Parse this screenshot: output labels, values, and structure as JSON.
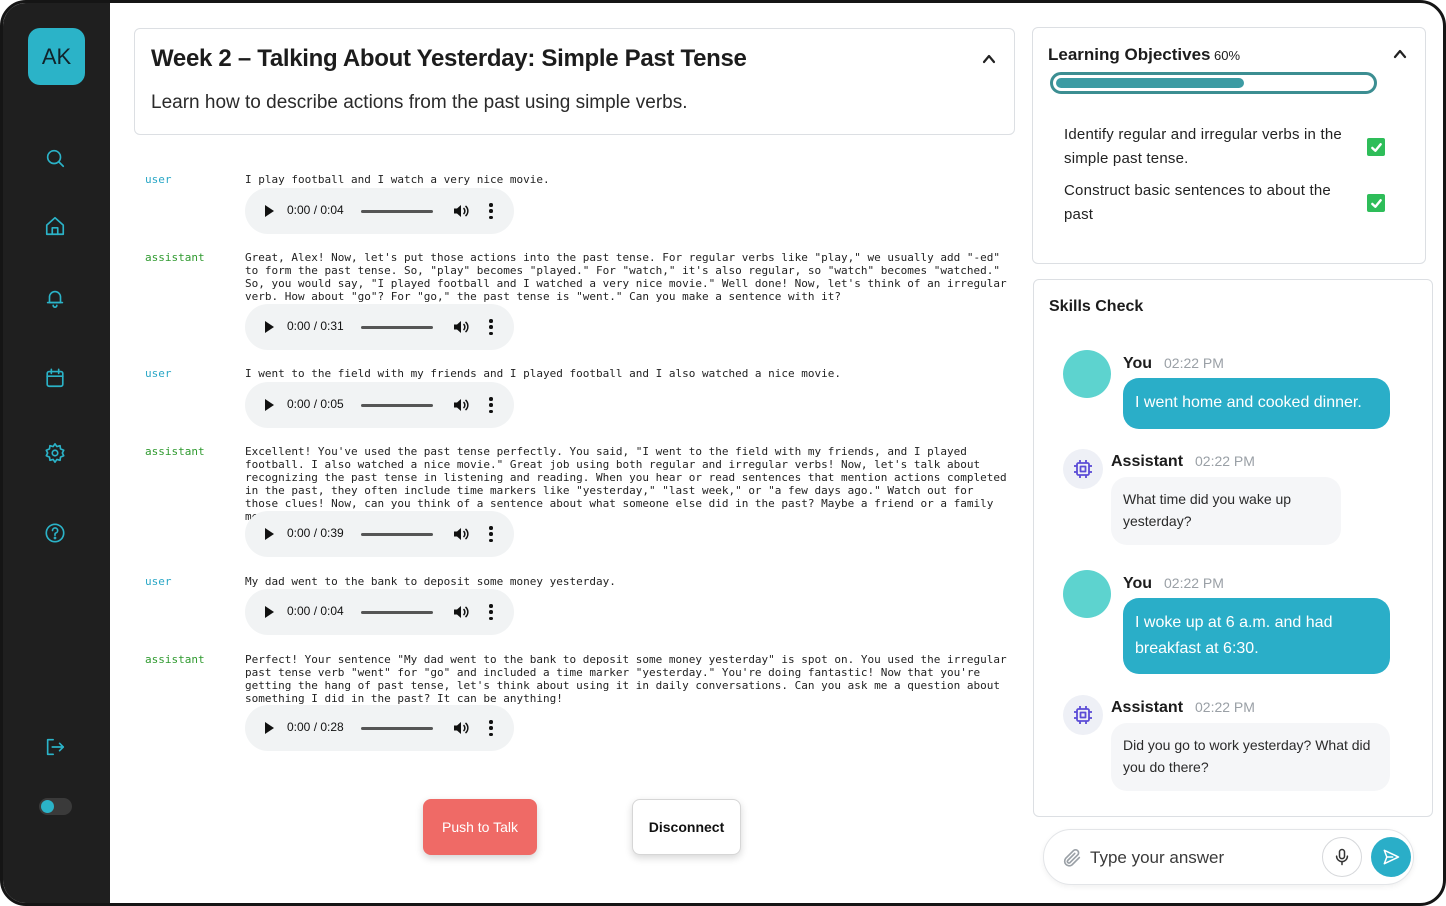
{
  "sidebar": {
    "avatar_initials": "AK",
    "items": [
      {
        "name": "search",
        "icon": "search-icon"
      },
      {
        "name": "home",
        "icon": "home-icon"
      },
      {
        "name": "notifications",
        "icon": "bell-icon"
      },
      {
        "name": "calendar",
        "icon": "calendar-icon"
      },
      {
        "name": "settings",
        "icon": "gear-icon"
      },
      {
        "name": "help",
        "icon": "help-icon"
      },
      {
        "name": "logout",
        "icon": "logout-icon"
      }
    ],
    "theme_toggle": "theme-toggle"
  },
  "lesson": {
    "title": "Week 2 – Talking About Yesterday: Simple Past Tense",
    "subtitle": "Learn how to describe actions from the past using simple verbs."
  },
  "transcript": [
    {
      "role": "user",
      "text": "I play football and I watch a very nice movie.",
      "audio_time": "0:00 / 0:04"
    },
    {
      "role": "assistant",
      "text": "Great, Alex! Now, let's put those actions into the past tense. For regular verbs like \"play,\" we usually add \"-ed\" to form the past tense. So, \"play\" becomes \"played.\" For \"watch,\" it's also regular, so \"watch\" becomes \"watched.\" So, you would say, \"I played football and I watched a very nice movie.\" Well done! Now, let's think of an irregular verb. How about \"go\"? For \"go,\" the past tense is \"went.\" Can you make a sentence with it?",
      "audio_time": "0:00 / 0:31"
    },
    {
      "role": "user",
      "text": "I went to the field with my friends and I played football and I also watched a nice movie.",
      "audio_time": "0:00 / 0:05"
    },
    {
      "role": "assistant",
      "text": "Excellent! You've used the past tense perfectly. You said, \"I went to the field with my friends, and I played football. I also watched a nice movie.\" Great job using both regular and irregular verbs! Now, let's talk about recognizing the past tense in listening and reading. When you hear or read sentences that mention actions completed in the past, they often include time markers like \"yesterday,\" \"last week,\" or \"a few days ago.\" Watch out for those clues! Now, can you think of a sentence about what someone else did in the past? Maybe a friend or a family member?",
      "audio_time": "0:00 / 0:39"
    },
    {
      "role": "user",
      "text": "My dad went to the bank to deposit some money yesterday.",
      "audio_time": "0:00 / 0:04"
    },
    {
      "role": "assistant",
      "text": "Perfect! Your sentence \"My dad went to the bank to deposit some money yesterday\" is spot on. You used the irregular past tense verb \"went\" for \"go\" and included a time marker \"yesterday.\" You're doing fantastic! Now that you're getting the hang of past tense, let's think about using it in daily conversations. Can you ask me a question about something I did in the past? It can be anything!",
      "audio_time": "0:00 / 0:28"
    }
  ],
  "controls": {
    "push_to_talk": "Push to Talk",
    "disconnect": "Disconnect"
  },
  "objectives": {
    "title": "Learning Objectives",
    "percent_label": "60%",
    "progress": 0.6,
    "items": [
      {
        "text": "Identify regular and irregular verbs in the simple past tense.",
        "checked": true
      },
      {
        "text": "Construct basic sentences to about the past",
        "checked": true
      }
    ]
  },
  "skills": {
    "title": "Skills Check",
    "messages": [
      {
        "sender": "You",
        "time": "02:22 PM",
        "text": "I went home and cooked dinner."
      },
      {
        "sender": "Assistant",
        "time": "02:22 PM",
        "text": "What time did you wake up yesterday?"
      },
      {
        "sender": "You",
        "time": "02:22 PM",
        "text": "I woke up at 6 a.m. and had breakfast at 6:30."
      },
      {
        "sender": "Assistant",
        "time": "02:22 PM",
        "text": "Did you go to work yesterday? What did you do there?"
      }
    ]
  },
  "composer": {
    "placeholder": "Type your answer",
    "value": ""
  },
  "colors": {
    "accent": "#2aaec8",
    "sidebar_bg": "#1f1f1f",
    "user_role": "#2aa7c6",
    "assistant_role": "#2f9a2f",
    "push_to_talk": "#ef6a66",
    "checkbox": "#2ebd59",
    "progress": "#3c9ba3"
  }
}
